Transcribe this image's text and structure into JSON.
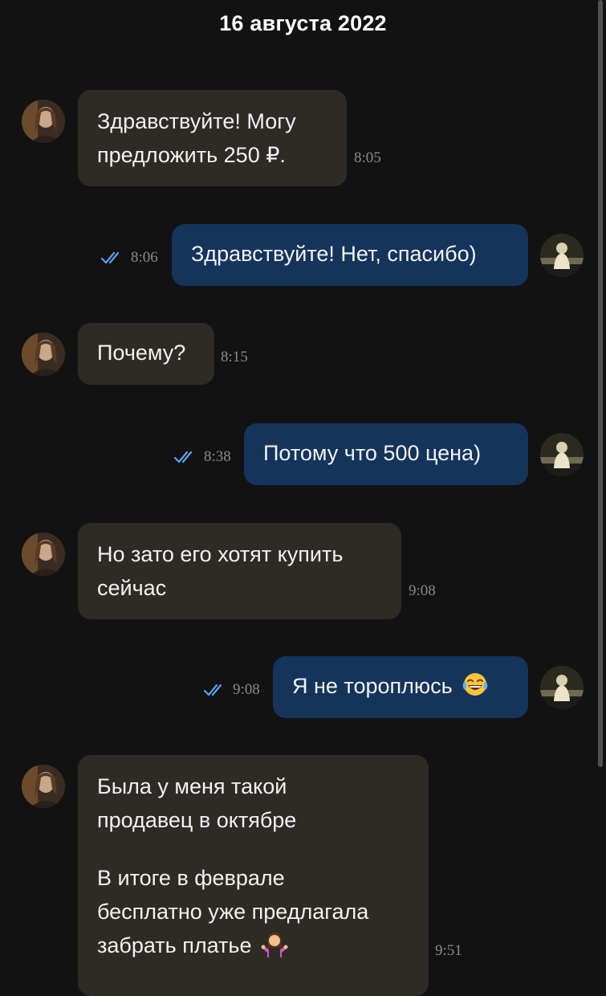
{
  "header": {
    "date": "16 августа 2022"
  },
  "messages": [
    {
      "side": "in",
      "lines": [
        "Здравствуйте! Могу",
        "предложить 250 ₽."
      ],
      "time": "8:05"
    },
    {
      "side": "out",
      "text": "Здравствуйте! Нет, спасибо)",
      "time": "8:06",
      "read": true
    },
    {
      "side": "in",
      "text": "Почему?",
      "time": "8:15"
    },
    {
      "side": "out",
      "text": "Потому что 500 цена)",
      "time": "8:38",
      "read": true
    },
    {
      "side": "in",
      "lines": [
        "Но зато его хотят купить",
        "сейчас"
      ],
      "time": "9:08"
    },
    {
      "side": "out",
      "text": "Я не тороплюсь",
      "emoji": "face-with-tears-of-joy",
      "time": "9:08",
      "read": true
    },
    {
      "side": "in",
      "paragraphs": [
        [
          "Была у меня такой",
          "продавец в октябре"
        ],
        [
          "В итоге в феврале",
          "бесплатно уже предлагала",
          "забрать платье"
        ]
      ],
      "emoji": "person-shrugging",
      "time": "9:51"
    }
  ],
  "colors": {
    "background": "#121212",
    "incoming_bubble": "#2e2a25",
    "outgoing_bubble": "#14345c",
    "read_ticks": "#5aa2f0",
    "timestamp": "#8a8a8a"
  }
}
